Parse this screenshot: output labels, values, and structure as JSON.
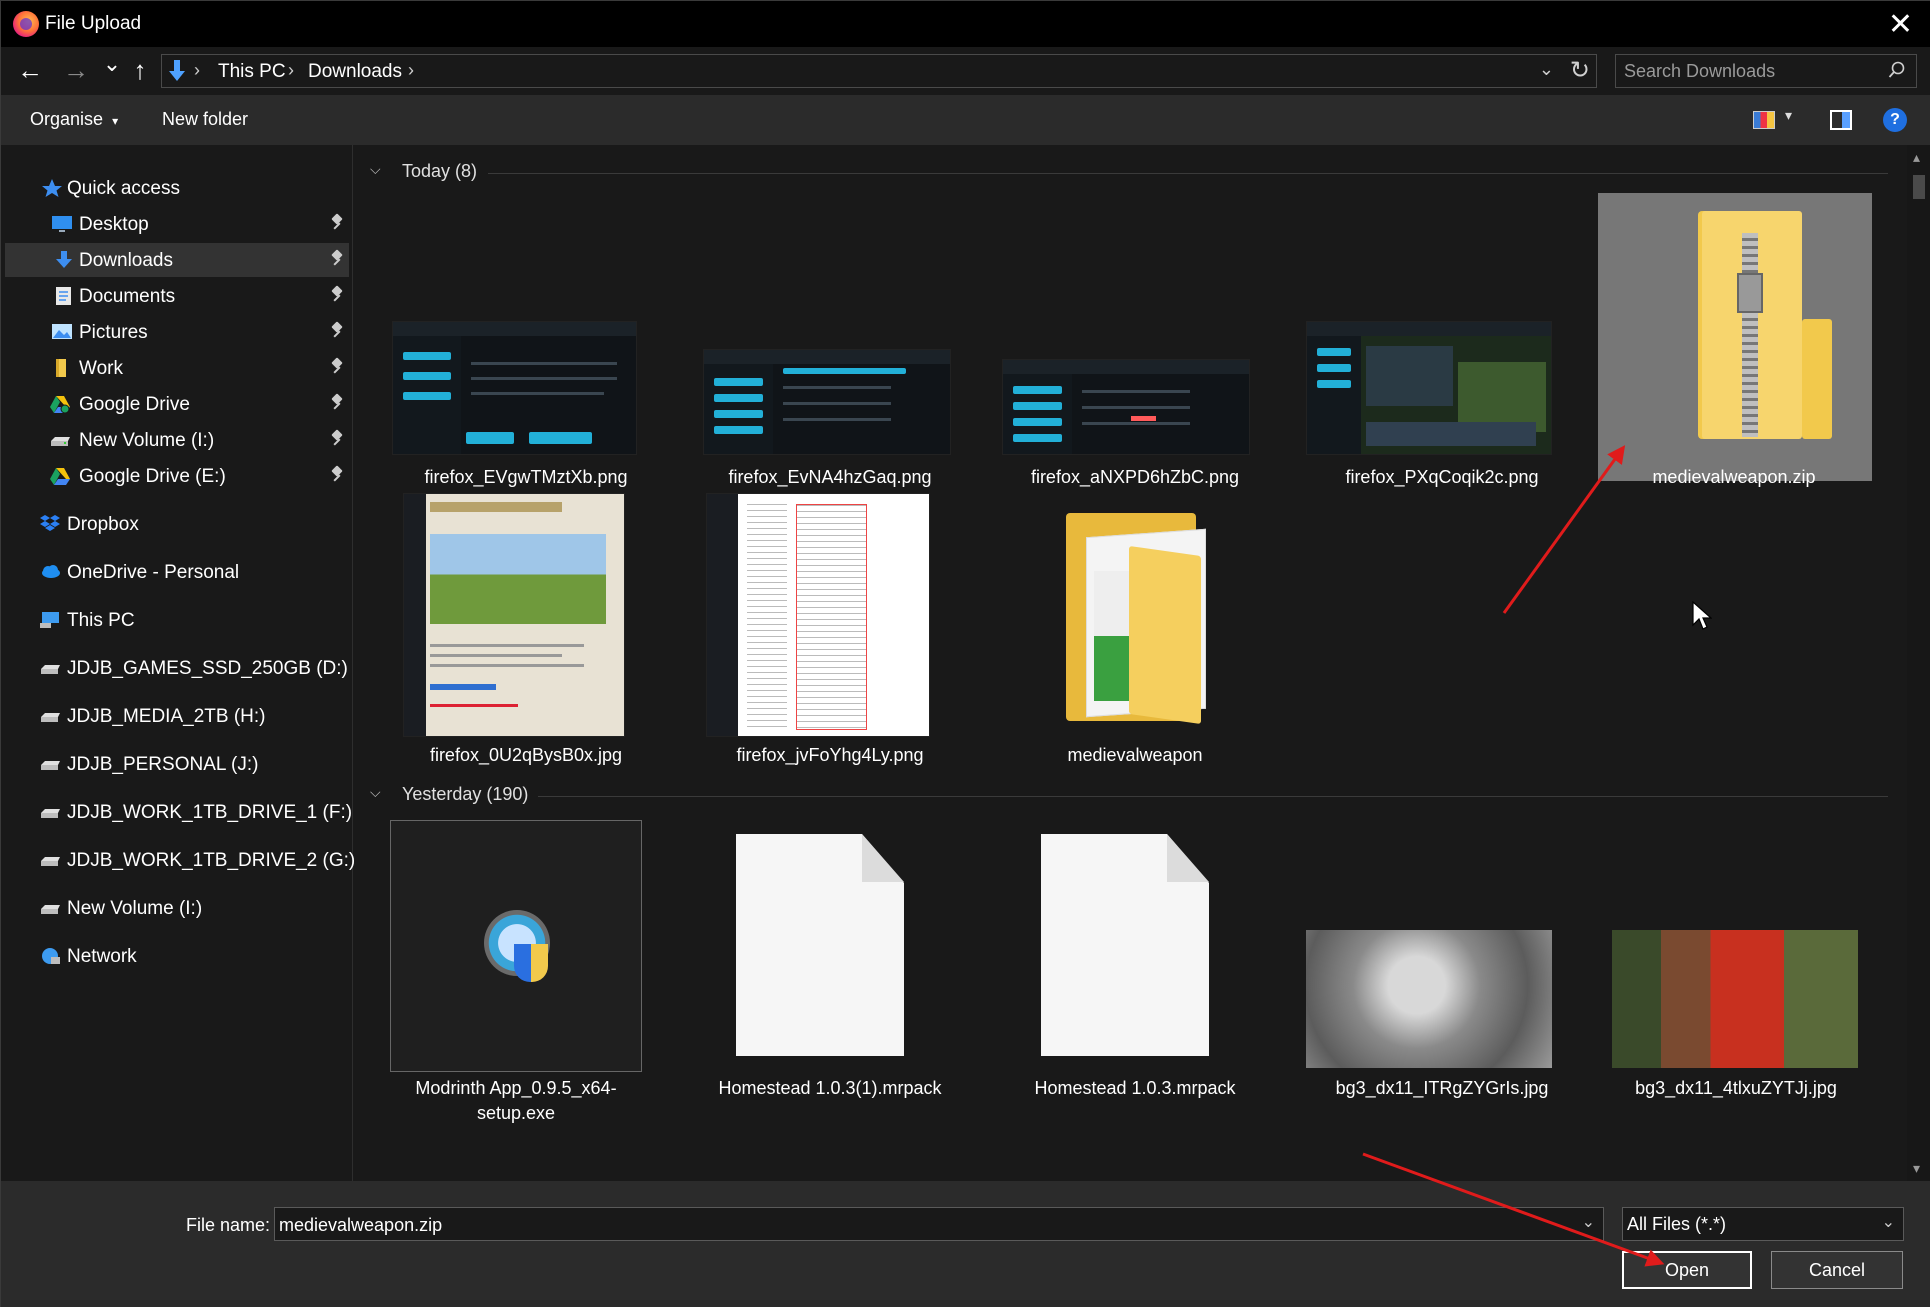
{
  "window": {
    "title": "File Upload",
    "close_glyph": "✕"
  },
  "address": {
    "back_glyph": "←",
    "forward_glyph": "→",
    "recent_glyph": "⌄",
    "up_glyph": "↑",
    "breadcrumb": [
      "This PC",
      "Downloads"
    ],
    "separator": "›",
    "dropdown_glyph": "⌄",
    "refresh_glyph": "↻"
  },
  "search": {
    "placeholder": "Search Downloads"
  },
  "toolbar": {
    "organise_label": "Organise",
    "new_folder_label": "New folder",
    "help_glyph": "?",
    "dd_glyph": "▾"
  },
  "sidebar": {
    "items": [
      {
        "label": "Quick access",
        "icon": "star-icon"
      },
      {
        "label": "Desktop",
        "icon": "desktop-icon",
        "pinned": true
      },
      {
        "label": "Downloads",
        "icon": "download-icon",
        "pinned": true,
        "selected": true
      },
      {
        "label": "Documents",
        "icon": "document-icon",
        "pinned": true
      },
      {
        "label": "Pictures",
        "icon": "pictures-icon",
        "pinned": true
      },
      {
        "label": "Work",
        "icon": "folder-icon",
        "pinned": true
      },
      {
        "label": "Google Drive",
        "icon": "google-drive-icon",
        "pinned": true
      },
      {
        "label": "New Volume (I:)",
        "icon": "drive-icon",
        "pinned": true
      },
      {
        "label": "Google Drive (E:)",
        "icon": "google-drive-icon",
        "pinned": true
      },
      {
        "label": "Dropbox",
        "icon": "dropbox-icon"
      },
      {
        "label": "OneDrive - Personal",
        "icon": "onedrive-icon"
      },
      {
        "label": "This PC",
        "icon": "pc-icon"
      },
      {
        "label": "JDJB_GAMES_SSD_250GB (D:)",
        "icon": "drive-icon"
      },
      {
        "label": "JDJB_MEDIA_2TB (H:)",
        "icon": "drive-icon"
      },
      {
        "label": "JDJB_PERSONAL (J:)",
        "icon": "drive-icon"
      },
      {
        "label": "JDJB_WORK_1TB_DRIVE_1 (F:)",
        "icon": "drive-icon"
      },
      {
        "label": "JDJB_WORK_1TB_DRIVE_2 (G:)",
        "icon": "drive-icon"
      },
      {
        "label": "New Volume (I:)",
        "icon": "drive-icon"
      },
      {
        "label": "Network",
        "icon": "network-icon"
      }
    ]
  },
  "groups": [
    {
      "title": "Today (8)",
      "files": [
        {
          "name": "firefox_EVgwTMztXb.png",
          "kind": "screenshot"
        },
        {
          "name": "firefox_EvNA4hzGaq.png",
          "kind": "screenshot"
        },
        {
          "name": "firefox_aNXPD6hZbC.png",
          "kind": "screenshot"
        },
        {
          "name": "firefox_PXqCoqik2c.png",
          "kind": "screenshot"
        },
        {
          "name": "medievalweapon.zip",
          "kind": "zip",
          "selected": true
        },
        {
          "name": "firefox_0U2qBysB0x.jpg",
          "kind": "webpage"
        },
        {
          "name": "firefox_jvFoYhg4Ly.png",
          "kind": "document"
        },
        {
          "name": "medievalweapon",
          "kind": "folder"
        }
      ]
    },
    {
      "title": "Yesterday (190)",
      "files": [
        {
          "name": "Modrinth App_0.9.5_x64-setup.exe",
          "kind": "installer"
        },
        {
          "name": "Homestead 1.0.3(1).mrpack",
          "kind": "blank"
        },
        {
          "name": "Homestead 1.0.3.mrpack",
          "kind": "blank"
        },
        {
          "name": "bg3_dx11_ITRgZYGrIs.jpg",
          "kind": "photo-grey"
        },
        {
          "name": "bg3_dx11_4tlxuZYTJj.jpg",
          "kind": "photo-color"
        }
      ]
    }
  ],
  "bottom": {
    "file_name_label": "File name:",
    "file_name_value": "medievalweapon.zip",
    "file_type_value": "All Files (*.*)",
    "open_label": "Open",
    "cancel_label": "Cancel"
  },
  "colors": {
    "accent": "#1f6fe0",
    "annotation_arrow": "#e01b1b",
    "selection": "#777777"
  }
}
